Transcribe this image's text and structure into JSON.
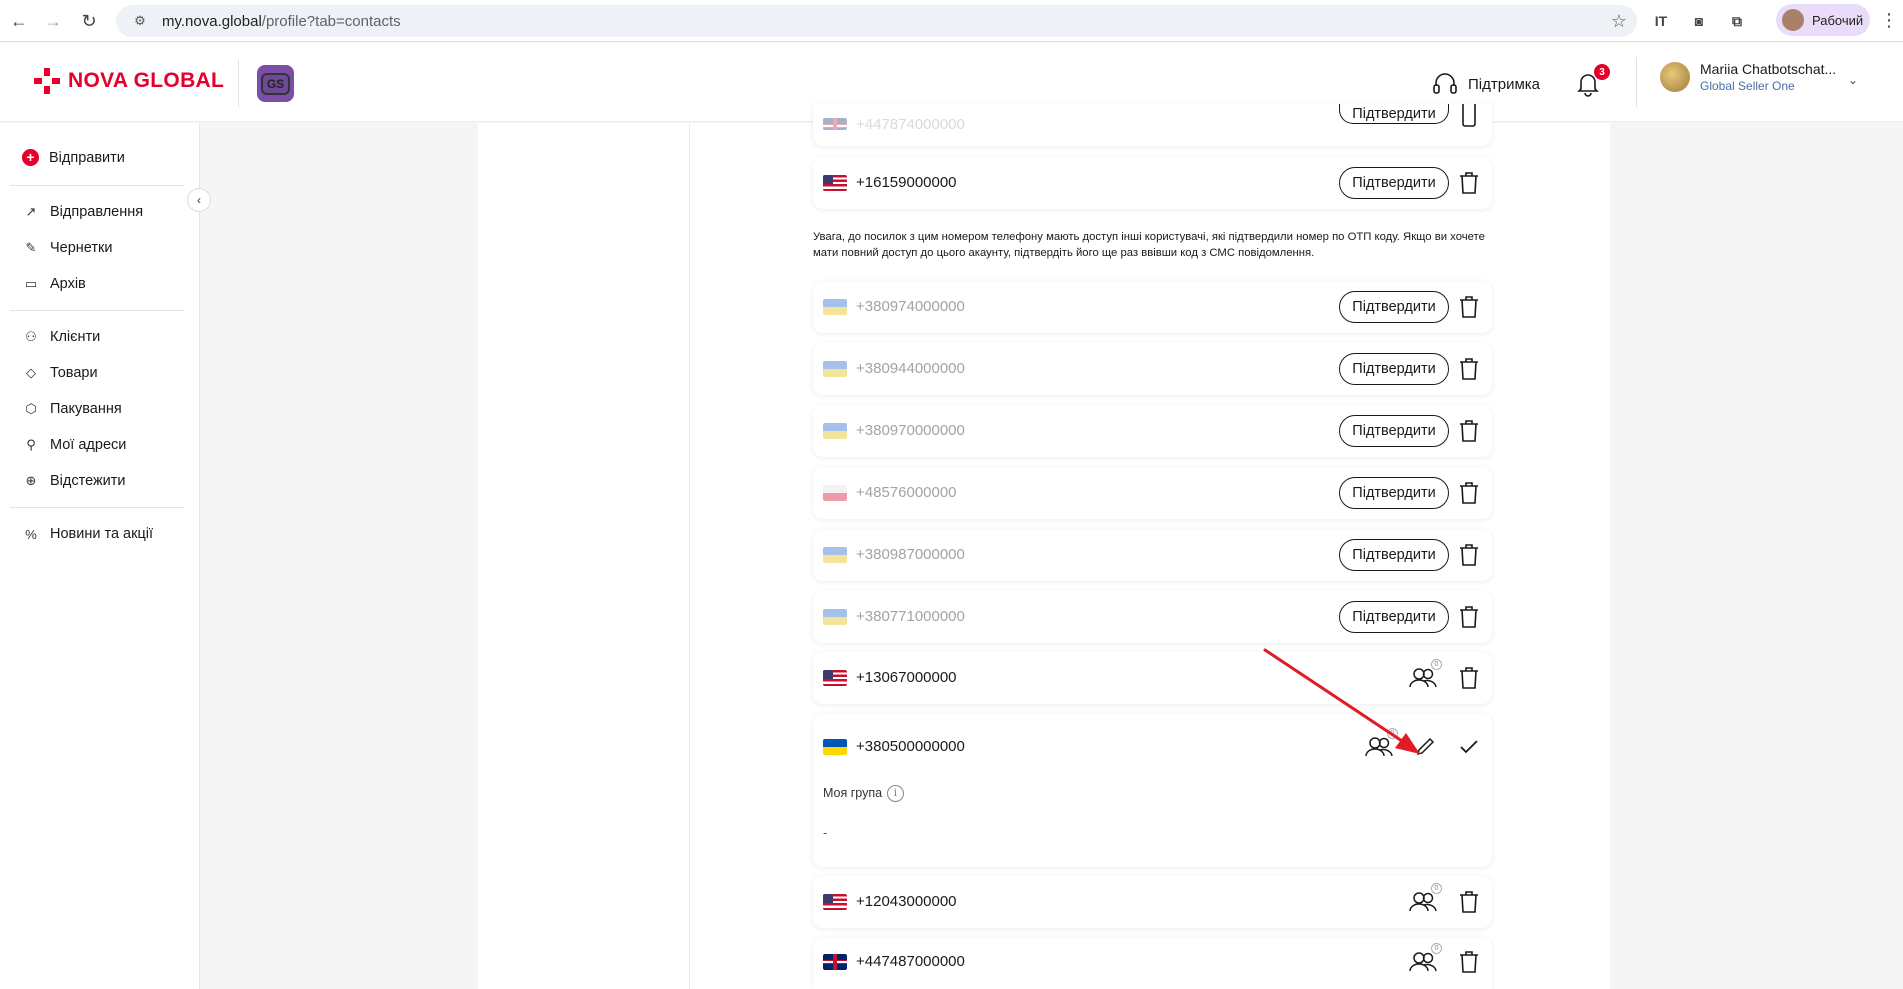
{
  "browser": {
    "url_domain": "my.nova.global",
    "url_path": "/profile?tab=contacts",
    "profile_label": "Рабочий"
  },
  "header": {
    "brand": "NOVA GLOBAL",
    "badge": "GS",
    "support_label": "Підтримка",
    "notifications_count": "3",
    "user_name": "Mariia Chatbotschat...",
    "user_role": "Global Seller One"
  },
  "sidebar": {
    "send_label": "Відправити",
    "items": [
      {
        "label": "Відправлення",
        "icon": "arrow-up-right-icon"
      },
      {
        "label": "Чернетки",
        "icon": "edit-icon"
      },
      {
        "label": "Архів",
        "icon": "archive-icon"
      },
      {
        "label": "Клієнти",
        "icon": "users-icon"
      },
      {
        "label": "Товари",
        "icon": "tag-icon"
      },
      {
        "label": "Пакування",
        "icon": "box-icon"
      },
      {
        "label": "Мої адреси",
        "icon": "location-icon"
      },
      {
        "label": "Відстежити",
        "icon": "crosshair-icon"
      },
      {
        "label": "Новини та акції",
        "icon": "percent-icon"
      }
    ]
  },
  "contacts": {
    "confirm_label": "Підтвердити",
    "notice": "Увага, до посилок з цим номером телефону мають доступ інші користувачі, які підтвердили номер по ОТП коду. Якщо ви хочете мати повний доступ до цього акаунту, підтвердіть його ще раз ввівши код з СМС повідомлення.",
    "partial_top_phone": "+447874000000",
    "first_phone": "+16159000000",
    "unconfirmed": [
      {
        "phone": "+380974000000",
        "flag": "ua"
      },
      {
        "phone": "+380944000000",
        "flag": "ua"
      },
      {
        "phone": "+380970000000",
        "flag": "ua"
      },
      {
        "phone": "+48576000000",
        "flag": "pl"
      },
      {
        "phone": "+380987000000",
        "flag": "ua"
      },
      {
        "phone": "+380771000000",
        "flag": "ua"
      }
    ],
    "confirmed_1": {
      "phone": "+13067000000",
      "group_count": "0"
    },
    "expanded": {
      "phone": "+380500000000",
      "group_label": "Моя група",
      "group_value": "-",
      "group_count": "0"
    },
    "confirmed_2": {
      "phone": "+12043000000",
      "group_count": "0"
    },
    "confirmed_3": {
      "phone": "+447487000000",
      "group_count": "0"
    }
  },
  "colors": {
    "brand_red": "#e4002b",
    "annotation_arrow": "#e01b24"
  }
}
